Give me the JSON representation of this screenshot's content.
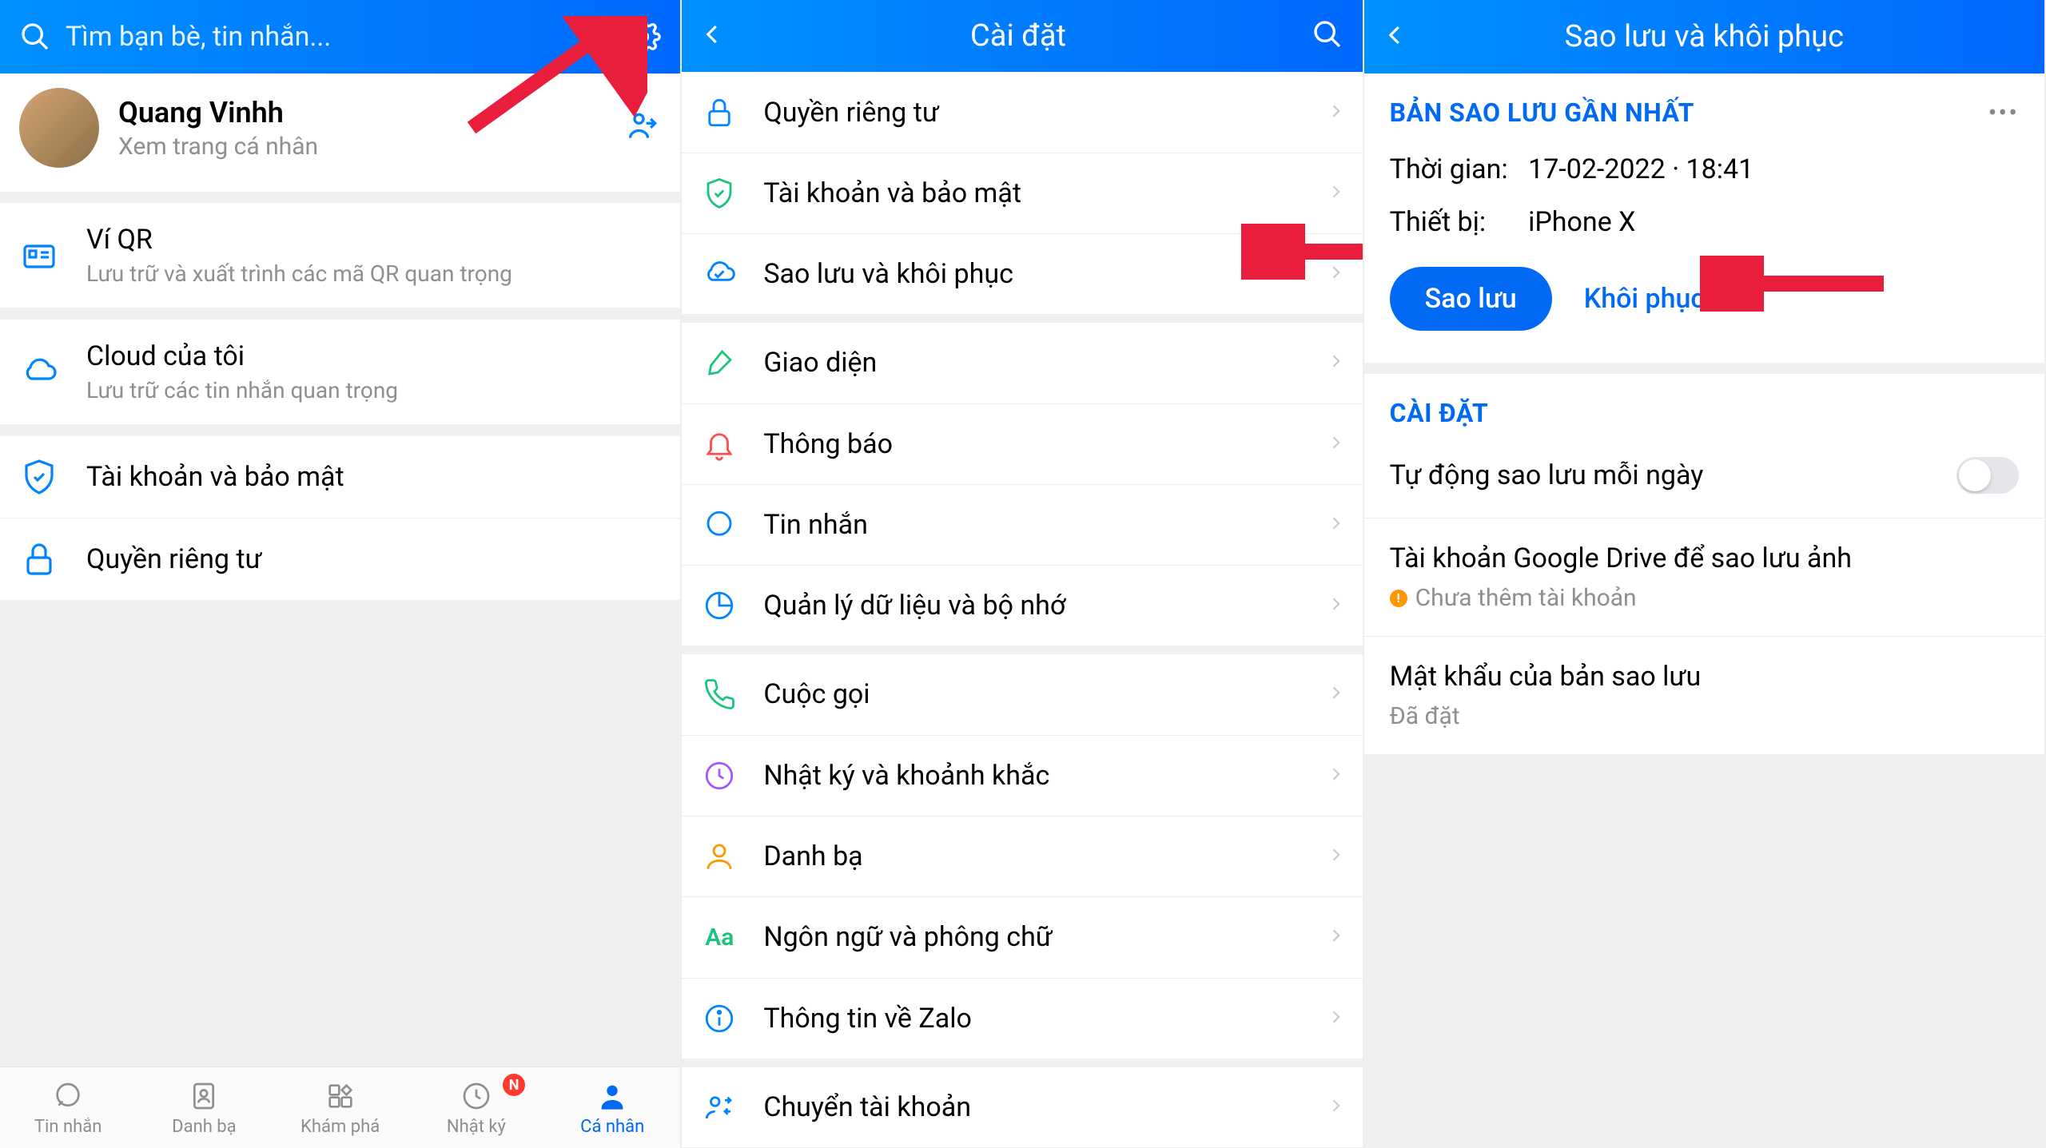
{
  "screen1": {
    "search_placeholder": "Tìm bạn bè, tin nhắn...",
    "profile": {
      "name": "Quang Vinhh",
      "sub": "Xem trang cá nhân"
    },
    "items": [
      {
        "title": "Ví QR",
        "sub": "Lưu trữ và xuất trình các mã QR quan trọng"
      },
      {
        "title": "Cloud của tôi",
        "sub": "Lưu trữ các tin nhắn quan trọng"
      },
      {
        "title": "Tài khoản và bảo mật",
        "sub": ""
      },
      {
        "title": "Quyền riêng tư",
        "sub": ""
      }
    ],
    "tabs": [
      "Tin nhắn",
      "Danh bạ",
      "Khám phá",
      "Nhật ký",
      "Cá nhân"
    ],
    "badge": "N"
  },
  "screen2": {
    "title": "Cài đặt",
    "groups": [
      [
        "Quyền riêng tư",
        "Tài khoản và bảo mật",
        "Sao lưu và khôi phục"
      ],
      [
        "Giao diện",
        "Thông báo",
        "Tin nhắn",
        "Quản lý dữ liệu và bộ nhớ"
      ],
      [
        "Cuộc gọi",
        "Nhật ký và khoảnh khắc",
        "Danh bạ",
        "Ngôn ngữ và phông chữ",
        "Thông tin về Zalo"
      ],
      [
        "Chuyển tài khoản"
      ]
    ]
  },
  "screen3": {
    "title": "Sao lưu và khôi phục",
    "section1_title": "BẢN SAO LƯU GẦN NHẤT",
    "time_label": "Thời gian:",
    "time_value": "17-02-2022 · 18:41",
    "device_label": "Thiết bị:",
    "device_value": "iPhone X",
    "btn_backup": "Sao lưu",
    "btn_restore": "Khôi phục",
    "section2_title": "CÀI ĐẶT",
    "settings": [
      {
        "label": "Tự động sao lưu mỗi ngày",
        "toggle": true
      },
      {
        "label": "Tài khoản Google Drive để sao lưu ảnh",
        "sub": "Chưa thêm tài khoản",
        "warn": true
      },
      {
        "label": "Mật khẩu của bản sao lưu",
        "sub": "Đã đặt"
      }
    ]
  }
}
